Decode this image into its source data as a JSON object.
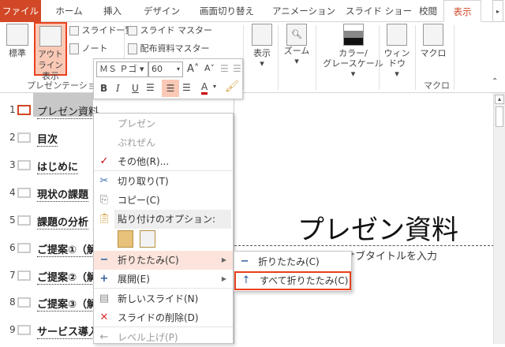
{
  "tabs": [
    "ファイル",
    "ホーム",
    "挿入",
    "デザイン",
    "画面切り替え",
    "アニメーション",
    "スライド ショー",
    "校閲",
    "表示"
  ],
  "ribbon": {
    "standard": "標準",
    "outline_view_1": "アウトライン",
    "outline_view_2": "表示",
    "slide_sorter": "スライド一覧",
    "notes": "ノート",
    "slide_master": "スライド マスター",
    "handout_master": "配布資料マスター",
    "show": "表示",
    "zoom": "ズーム",
    "color_gray_1": "カラー/",
    "color_gray_2": "グレースケール",
    "window": "ウィンドウ",
    "macro": "マクロ",
    "group_presentation": "プレゼンテーション",
    "group_macro": "マクロ"
  },
  "mini_toolbar": {
    "font": "ＭＳ Ｐゴ",
    "size": "60",
    "bold": "B",
    "italic": "I",
    "underline": "U",
    "font_color": "A"
  },
  "outline": [
    {
      "n": "1",
      "text": "プレゼン資料"
    },
    {
      "n": "2",
      "text": "目次"
    },
    {
      "n": "3",
      "text": "はじめに"
    },
    {
      "n": "4",
      "text": "現状の課題"
    },
    {
      "n": "5",
      "text": "課題の分析"
    },
    {
      "n": "6",
      "text": "ご提案①（解"
    },
    {
      "n": "7",
      "text": "ご提案②（解"
    },
    {
      "n": "8",
      "text": "ご提案③（解"
    },
    {
      "n": "9",
      "text": "サービス導入"
    }
  ],
  "slide": {
    "title": "プレゼン資料",
    "subtitle": "サブタイトルを入力"
  },
  "context_menu": {
    "s1": "プレゼン",
    "s2": "ぷれぜん",
    "more": "その他(R)...",
    "cut": "切り取り(T)",
    "copy": "コピー(C)",
    "paste_options": "貼り付けのオプション:",
    "collapse": "折りたたみ(C)",
    "expand": "展開(E)",
    "new_slide": "新しいスライド(N)",
    "delete_slide": "スライドの削除(D)",
    "promote": "レベル上げ(P)"
  },
  "submenu": {
    "collapse": "折りたたみ(C)",
    "collapse_all": "すべて折りたたみ(C)"
  },
  "colors": {
    "accent": "#d24726",
    "highlight": "#e8401c"
  }
}
